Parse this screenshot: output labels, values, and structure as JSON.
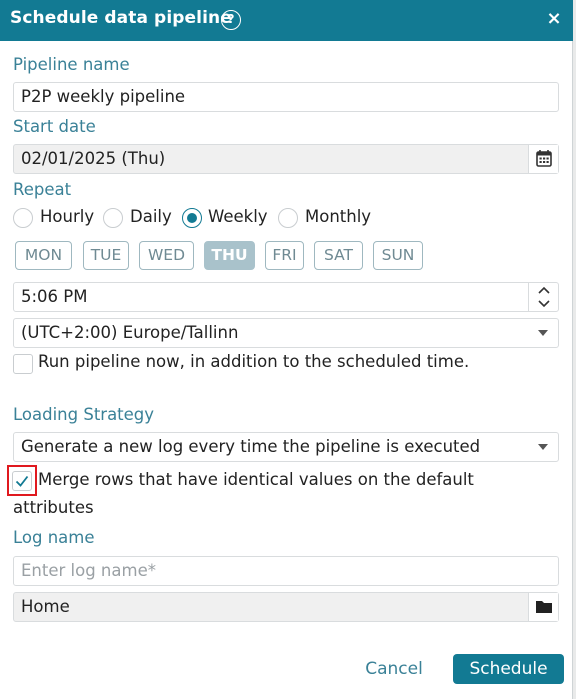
{
  "dialog": {
    "title": "Schedule data pipeline",
    "help_glyph": "?",
    "close_glyph": "×"
  },
  "pipeline_name": {
    "label": "Pipeline name",
    "value": "P2P weekly pipeline"
  },
  "start_date": {
    "label": "Start date",
    "value": "02/01/2025 (Thu)"
  },
  "repeat": {
    "label": "Repeat",
    "options": [
      {
        "label": "Hourly",
        "checked": false
      },
      {
        "label": "Daily",
        "checked": false
      },
      {
        "label": "Weekly",
        "checked": true
      },
      {
        "label": "Monthly",
        "checked": false
      }
    ],
    "days": [
      {
        "label": "MON",
        "active": false
      },
      {
        "label": "TUE",
        "active": false
      },
      {
        "label": "WED",
        "active": false
      },
      {
        "label": "THU",
        "active": true
      },
      {
        "label": "FRI",
        "active": false
      },
      {
        "label": "SAT",
        "active": false
      },
      {
        "label": "SUN",
        "active": false
      }
    ]
  },
  "time": {
    "value": "5:06 PM"
  },
  "timezone": {
    "value": "(UTC+2:00) Europe/Tallinn"
  },
  "run_now": {
    "label": "Run pipeline now, in addition to the scheduled time.",
    "checked": false
  },
  "loading_strategy": {
    "label": "Loading Strategy",
    "value": "Generate a new log every time the pipeline is executed"
  },
  "merge_rows": {
    "label_line1": "Merge rows that have identical values on the default",
    "label_line2": "attributes",
    "checked": true
  },
  "log_name": {
    "label": "Log name",
    "placeholder": "Enter log name*",
    "value": ""
  },
  "log_location": {
    "value": "Home"
  },
  "footer": {
    "cancel_label": "Cancel",
    "schedule_label": "Schedule"
  },
  "colors": {
    "accent": "#127a93",
    "label": "#3a8197",
    "highlight_box": "#e0191f"
  }
}
